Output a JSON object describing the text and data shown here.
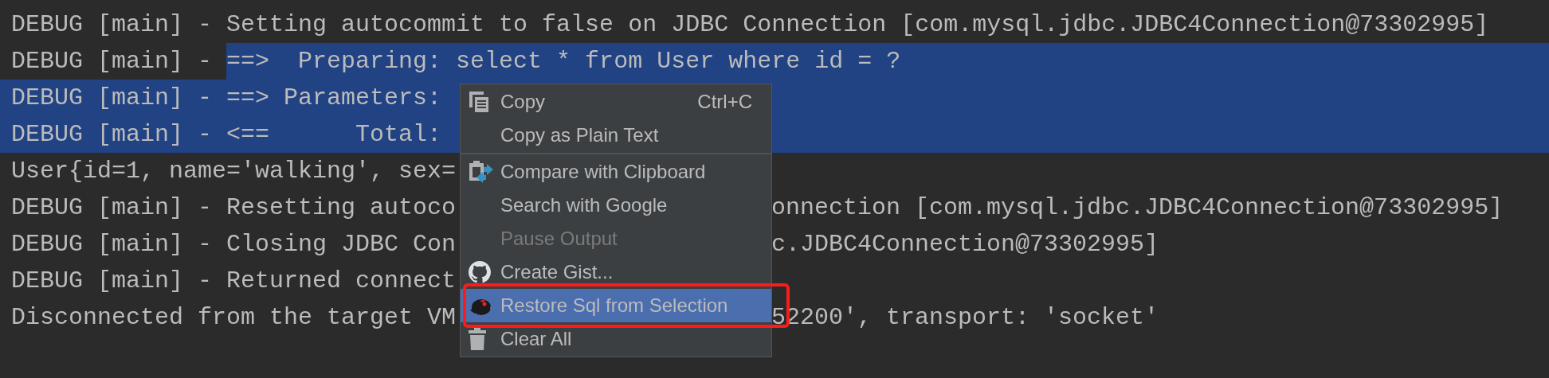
{
  "console": {
    "lines": [
      {
        "left": "DEBUG [main] - Setting autocommit to false on JDBC Connection [com.mysql.jdbc.JDBC4Connection@73302995]",
        "selected": false
      },
      {
        "left": "DEBUG [main] - ",
        "selected_text": "==>  Preparing: select * from User where id = ?",
        "selected": false
      },
      {
        "left": "DEBUG [main] - ==> Parameters:",
        "selected": true
      },
      {
        "left": "DEBUG [main] - <==      Total:",
        "selected": true
      },
      {
        "left": "User{id=1, name='walking', sex=",
        "selected": false
      },
      {
        "left": "DEBUG [main] - Resetting autoco",
        "right": "onnection [com.mysql.jdbc.JDBC4Connection@73302995]",
        "selected": false
      },
      {
        "left": "DEBUG [main] - Closing JDBC Con",
        "right": "c.JDBC4Connection@73302995]",
        "selected": false
      },
      {
        "left": "DEBUG [main] - Returned connect",
        "selected": false
      },
      {
        "left": "Disconnected from the target VM",
        "right": "52200', transport: 'socket'",
        "selected": false
      }
    ]
  },
  "context_menu": {
    "groups": [
      [
        {
          "label": "Copy",
          "shortcut": "Ctrl+C",
          "disabled": false,
          "selected": false,
          "outlined": false
        },
        {
          "label": "Copy as Plain Text",
          "disabled": false,
          "selected": false,
          "outlined": false
        }
      ],
      [
        {
          "label": "Compare with Clipboard",
          "disabled": false,
          "selected": false,
          "outlined": false
        },
        {
          "label": "Search with Google",
          "disabled": false,
          "selected": false,
          "outlined": false
        },
        {
          "label": "Pause Output",
          "disabled": true,
          "selected": false,
          "outlined": false
        },
        {
          "label": "Create Gist...",
          "disabled": false,
          "selected": false,
          "outlined": false
        },
        {
          "label": "Restore Sql from Selection",
          "disabled": false,
          "selected": true,
          "outlined": true
        },
        {
          "label": "Clear All",
          "disabled": false,
          "selected": false,
          "outlined": false
        }
      ]
    ]
  }
}
